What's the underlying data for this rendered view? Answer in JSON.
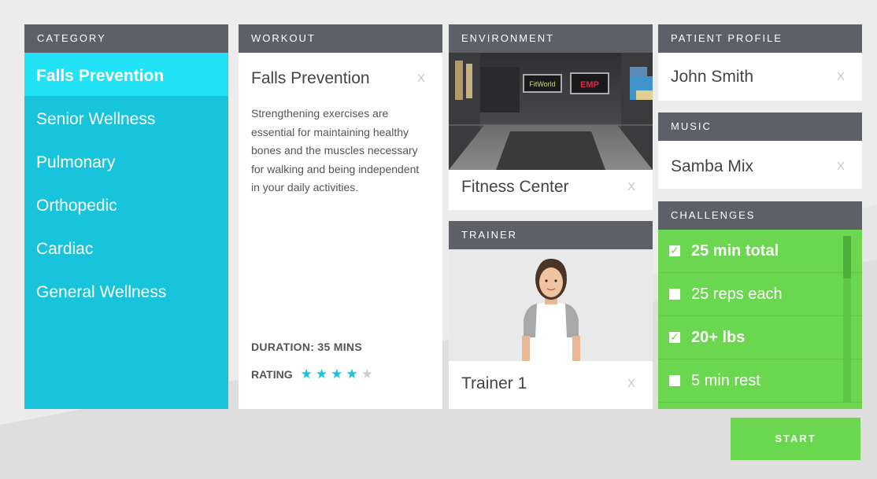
{
  "category": {
    "header": "CATEGORY",
    "items": [
      {
        "label": "Falls Prevention",
        "selected": true
      },
      {
        "label": "Senior Wellness",
        "selected": false
      },
      {
        "label": "Pulmonary",
        "selected": false
      },
      {
        "label": "Orthopedic",
        "selected": false
      },
      {
        "label": "Cardiac",
        "selected": false
      },
      {
        "label": "General Wellness",
        "selected": false
      }
    ]
  },
  "workout": {
    "header": "WORKOUT",
    "name": "Falls Prevention",
    "clear": "X",
    "description": "Strengthening exercises are essential for maintaining healthy bones and the muscles necessary for walking and being independent in your daily activities.",
    "duration": "DURATION: 35 MINS",
    "rating_label": "RATING",
    "rating_value": 4,
    "rating_max": 5
  },
  "environment": {
    "header": "ENVIRONMENT",
    "name": "Fitness Center",
    "clear": "X",
    "screen_labels": [
      "FitWorld",
      "EMP"
    ]
  },
  "trainer": {
    "header": "TRAINER",
    "name": "Trainer 1",
    "clear": "X"
  },
  "patient_profile": {
    "header": "PATIENT PROFILE",
    "name": "John Smith",
    "clear": "X"
  },
  "music": {
    "header": "MUSIC",
    "name": "Samba Mix",
    "clear": "X"
  },
  "challenges": {
    "header": "CHALLENGES",
    "items": [
      {
        "label": "25 min total",
        "checked": true
      },
      {
        "label": "25 reps each",
        "checked": false
      },
      {
        "label": "20+ lbs",
        "checked": true
      },
      {
        "label": "5 min rest",
        "checked": false
      }
    ]
  },
  "start_label": "START",
  "colors": {
    "header_bg": "#5e6068",
    "category_bg": "#18c3dc",
    "category_selected": "#22e2f6",
    "challenge_bg": "#6bd64f",
    "star_on": "#18c3dc",
    "star_off": "#cfcfcf"
  }
}
